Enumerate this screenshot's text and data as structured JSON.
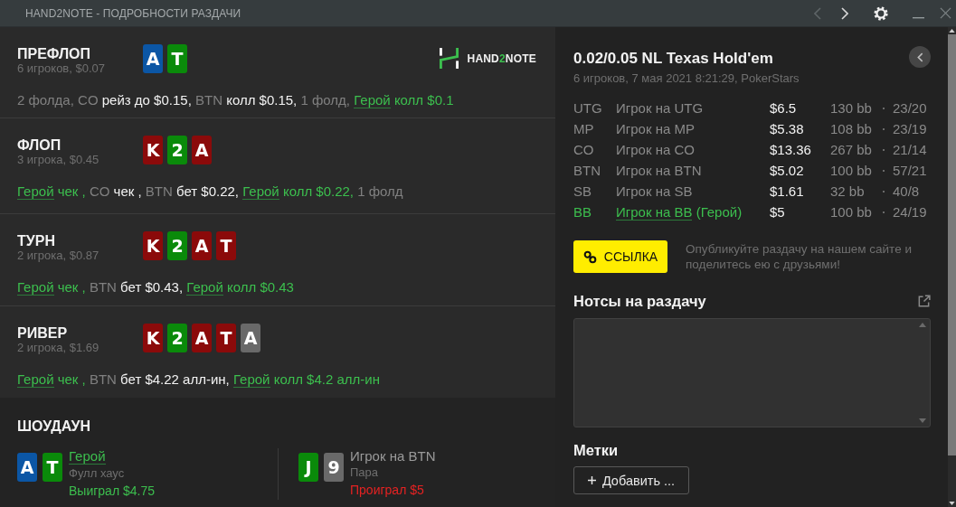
{
  "window": {
    "title": "HAND2NOTE - ПОДРОБНОСТИ РАЗДАЧИ",
    "nav": [
      {
        "kind": "prev",
        "disabled": true
      },
      {
        "kind": "next",
        "disabled": false
      }
    ]
  },
  "logo": {
    "parts": [
      {
        "text": "HAND",
        "accent": false
      },
      {
        "text": "2",
        "accent": true
      },
      {
        "text": "NOTE",
        "accent": false
      }
    ]
  },
  "streets": [
    {
      "name": "ПРЕФЛОП",
      "summary": "6 игроков, $0.07",
      "cards": [
        {
          "rank": "A",
          "color": "#0b56a5"
        },
        {
          "rank": "T",
          "color": "#0a8a0a"
        }
      ],
      "actions": [
        {
          "text": "2 фолда,",
          "kind": "muted"
        },
        {
          "text": "CO",
          "kind": "muted"
        },
        {
          "text": "рейз до $0.15,",
          "kind": "action"
        },
        {
          "text": "BTN",
          "kind": "muted"
        },
        {
          "text": "колл $0.15,",
          "kind": "action"
        },
        {
          "text": "1 фолд,",
          "kind": "muted"
        },
        {
          "text": "Герой",
          "kind": "hero"
        },
        {
          "text": "колл $0.1",
          "kind": "hero-action"
        }
      ]
    },
    {
      "name": "ФЛОП",
      "summary": "3 игрока, $0.45",
      "cards": [
        {
          "rank": "K",
          "color": "#8b0a0a"
        },
        {
          "rank": "2",
          "color": "#0a8a0a"
        },
        {
          "rank": "A",
          "color": "#8b0a0a"
        }
      ],
      "actions": [
        {
          "text": "Герой",
          "kind": "hero"
        },
        {
          "text": "чек ,",
          "kind": "hero-action"
        },
        {
          "text": "CO",
          "kind": "muted"
        },
        {
          "text": "чек ,",
          "kind": "action"
        },
        {
          "text": "BTN",
          "kind": "muted"
        },
        {
          "text": "бет $0.22,",
          "kind": "action"
        },
        {
          "text": "Герой",
          "kind": "hero"
        },
        {
          "text": "колл $0.22,",
          "kind": "hero-action"
        },
        {
          "text": "1 фолд",
          "kind": "muted"
        }
      ]
    },
    {
      "name": "ТУРН",
      "summary": "2 игрока, $0.87",
      "cards": [
        {
          "rank": "K",
          "color": "#8b0a0a"
        },
        {
          "rank": "2",
          "color": "#0a8a0a"
        },
        {
          "rank": "A",
          "color": "#8b0a0a"
        },
        {
          "rank": "T",
          "color": "#8b0a0a"
        }
      ],
      "actions": [
        {
          "text": "Герой",
          "kind": "hero"
        },
        {
          "text": "чек ,",
          "kind": "hero-action"
        },
        {
          "text": "BTN",
          "kind": "muted"
        },
        {
          "text": "бет $0.43,",
          "kind": "action"
        },
        {
          "text": "Герой",
          "kind": "hero"
        },
        {
          "text": "колл $0.43",
          "kind": "hero-action"
        }
      ]
    },
    {
      "name": "РИВЕР",
      "summary": "2 игрока, $1.69",
      "cards": [
        {
          "rank": "K",
          "color": "#8b0a0a"
        },
        {
          "rank": "2",
          "color": "#0a8a0a"
        },
        {
          "rank": "A",
          "color": "#8b0a0a"
        },
        {
          "rank": "T",
          "color": "#8b0a0a"
        },
        {
          "rank": "A",
          "color": "#696969"
        }
      ],
      "actions": [
        {
          "text": "Герой",
          "kind": "hero"
        },
        {
          "text": "чек ,",
          "kind": "hero-action"
        },
        {
          "text": "BTN",
          "kind": "muted"
        },
        {
          "text": "бет $4.22 алл-ин,",
          "kind": "action"
        },
        {
          "text": "Герой",
          "kind": "hero"
        },
        {
          "text": "колл $4.2 алл-ин",
          "kind": "hero-action"
        }
      ]
    }
  ],
  "showdown": {
    "title": "ШОУДАУН",
    "players": [
      {
        "name": "Герой",
        "hero": true,
        "cards": [
          {
            "rank": "A",
            "color": "#0b56a5"
          },
          {
            "rank": "T",
            "color": "#0a8a0a"
          }
        ],
        "hand": "Фулл хаус",
        "result": "Выиграл $4.75",
        "won": true
      },
      {
        "name": "Игрок на BTN",
        "hero": false,
        "cards": [
          {
            "rank": "J",
            "color": "#0a8a0a"
          },
          {
            "rank": "9",
            "color": "#696969"
          }
        ],
        "hand": "Пара",
        "result": "Проиграл $5",
        "won": false
      }
    ]
  },
  "hand_info": {
    "title": "0.02/0.05 NL Texas Hold'em",
    "subtitle": "6 игроков, 7 мая 2021 8:21:29, PokerStars",
    "players": [
      {
        "position": "UTG",
        "name": "Игрок на UTG",
        "stack": "$6.5",
        "bb": "130 bb",
        "stats": "23/20",
        "hero": false
      },
      {
        "position": "MP",
        "name": "Игрок на MP",
        "stack": "$5.38",
        "bb": "108 bb",
        "stats": "23/19",
        "hero": false
      },
      {
        "position": "CO",
        "name": "Игрок на CO",
        "stack": "$13.36",
        "bb": "267 bb",
        "stats": "21/14",
        "hero": false
      },
      {
        "position": "BTN",
        "name": "Игрок на BTN",
        "stack": "$5.02",
        "bb": "100 bb",
        "stats": "57/21",
        "hero": false
      },
      {
        "position": "SB",
        "name": "Игрок на SB",
        "stack": "$1.61",
        "bb": "32 bb",
        "stats": "40/8",
        "hero": false
      },
      {
        "position": "BB",
        "name": "Игрок на BB",
        "hero_label": "(Герой)",
        "stack": "$5",
        "bb": "100 bb",
        "stats": "24/19",
        "hero": true
      }
    ]
  },
  "share": {
    "button": "ССЫЛКА",
    "text": "Опубликуйте раздачу на нашем сайте и поделитесь ею с друзьями!"
  },
  "notes": {
    "title": "Нотсы на раздачу"
  },
  "tags": {
    "title": "Метки",
    "button": "Добавить ..."
  }
}
